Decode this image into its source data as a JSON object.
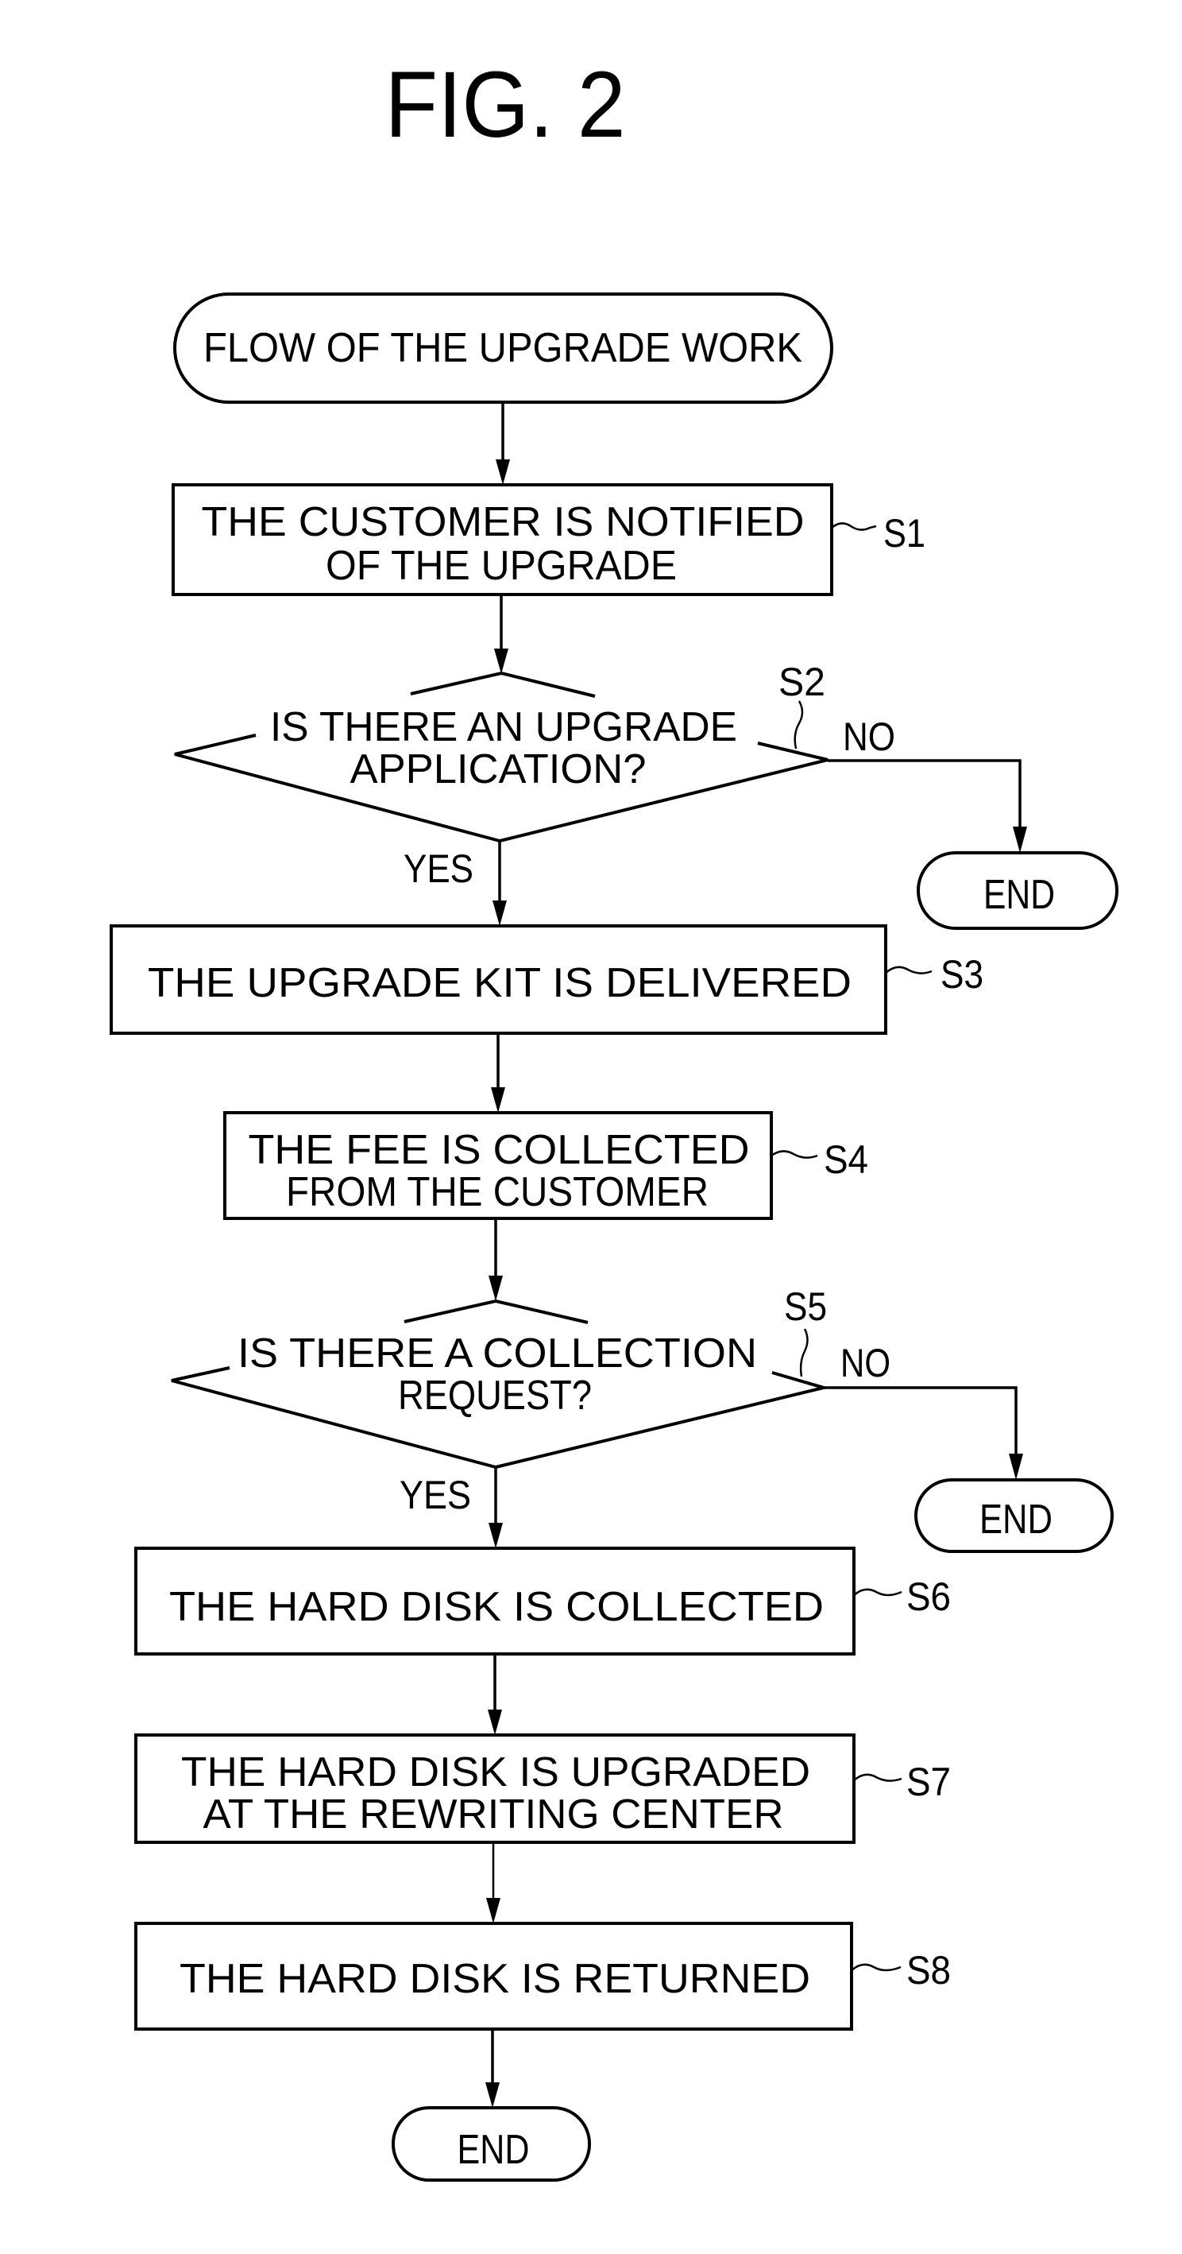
{
  "figure": {
    "title": "FIG. 2",
    "caption_subject": "Flow of the upgrade work"
  },
  "nodes": {
    "start": {
      "kind": "terminal",
      "lines": [
        "FLOW OF THE UPGRADE WORK"
      ]
    },
    "s1": {
      "kind": "process",
      "step": "S1",
      "lines": [
        "THE CUSTOMER IS NOTIFIED",
        "OF THE UPGRADE"
      ]
    },
    "s2": {
      "kind": "decision",
      "step": "S2",
      "lines": [
        "IS THERE AN UPGRADE",
        "APPLICATION?"
      ],
      "yes_label": "YES",
      "no_label": "NO"
    },
    "end_s2": {
      "kind": "terminal",
      "lines": [
        "END"
      ]
    },
    "s3": {
      "kind": "process",
      "step": "S3",
      "lines": [
        "THE UPGRADE KIT IS DELIVERED"
      ]
    },
    "s4": {
      "kind": "process",
      "step": "S4",
      "lines": [
        "THE FEE IS COLLECTED",
        "FROM THE CUSTOMER"
      ]
    },
    "s5": {
      "kind": "decision",
      "step": "S5",
      "lines": [
        "IS THERE A COLLECTION",
        "REQUEST?"
      ],
      "yes_label": "YES",
      "no_label": "NO"
    },
    "end_s5": {
      "kind": "terminal",
      "lines": [
        "END"
      ]
    },
    "s6": {
      "kind": "process",
      "step": "S6",
      "lines": [
        "THE HARD DISK IS COLLECTED"
      ]
    },
    "s7": {
      "kind": "process",
      "step": "S7",
      "lines": [
        "THE HARD DISK IS UPGRADED",
        "AT THE REWRITING CENTER"
      ]
    },
    "s8": {
      "kind": "process",
      "step": "S8",
      "lines": [
        "THE HARD DISK IS RETURNED"
      ]
    },
    "end_final": {
      "kind": "terminal",
      "lines": [
        "END"
      ]
    }
  },
  "edges": [
    {
      "from": "start",
      "to": "s1"
    },
    {
      "from": "s1",
      "to": "s2"
    },
    {
      "from": "s2",
      "to": "s3",
      "label": "YES"
    },
    {
      "from": "s2",
      "to": "end_s2",
      "label": "NO"
    },
    {
      "from": "s3",
      "to": "s4"
    },
    {
      "from": "s4",
      "to": "s5"
    },
    {
      "from": "s5",
      "to": "s6",
      "label": "YES"
    },
    {
      "from": "s5",
      "to": "end_s5",
      "label": "NO"
    },
    {
      "from": "s6",
      "to": "s7"
    },
    {
      "from": "s7",
      "to": "s8"
    },
    {
      "from": "s8",
      "to": "end_final"
    }
  ]
}
